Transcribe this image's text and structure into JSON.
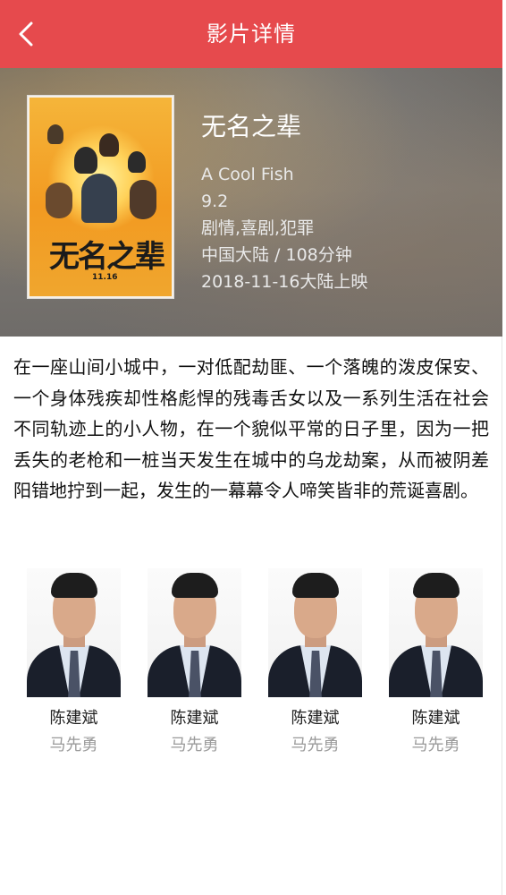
{
  "header": {
    "title": "影片详情",
    "back_icon": "chevron-left-icon",
    "background": "#e64a4d"
  },
  "movie": {
    "title": "无名之辈",
    "english_title": "A Cool Fish",
    "rating": "9.2",
    "genres": "剧情,喜剧,犯罪",
    "region_duration": "中国大陆 / 108分钟",
    "release": "2018-11-16大陆上映",
    "poster": {
      "logo_text": "无名之辈",
      "date_text": "11.16"
    }
  },
  "synopsis": "在一座山间小城中，一对低配劫匪、一个落魄的泼皮保安、一个身体残疾却性格彪悍的残毒舌女以及一系列生活在社会不同轨迹上的小人物，在一个貌似平常的日子里，因为一把丢失的老枪和一桩当天发生在城中的乌龙劫案，从而被阴差阳错地拧到一起，发生的一幕幕令人啼笑皆非的荒诞喜剧。",
  "cast": [
    {
      "name": "陈建斌",
      "role": "马先勇"
    },
    {
      "name": "陈建斌",
      "role": "马先勇"
    },
    {
      "name": "陈建斌",
      "role": "马先勇"
    },
    {
      "name": "陈建斌",
      "role": "马先勇"
    }
  ]
}
